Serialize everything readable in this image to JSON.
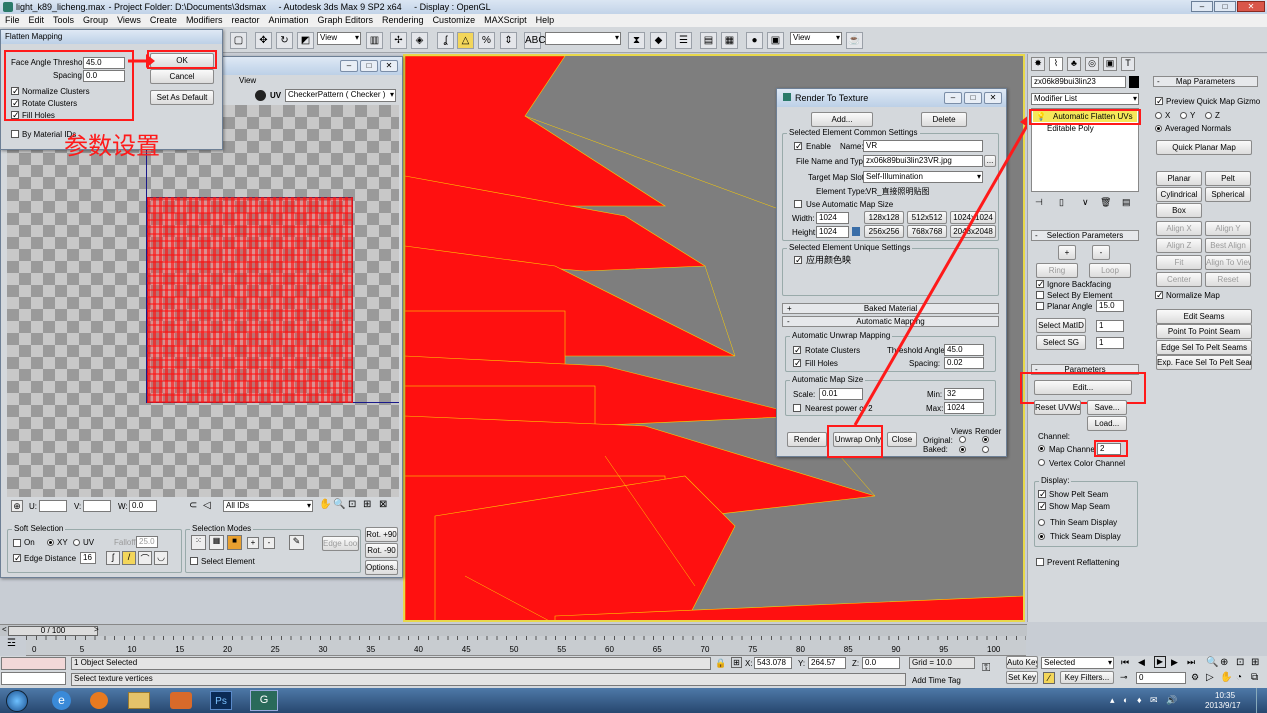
{
  "window": {
    "file": "light_k89_licheng.max",
    "title": " - Project Folder: D:\\Documents\\3dsmax     - Autodesk 3ds Max 9 SP2 x64     - Display : OpenGL"
  },
  "menu": [
    "File",
    "Edit",
    "Tools",
    "Group",
    "Views",
    "Create",
    "Modifiers",
    "reactor",
    "Animation",
    "Graph Editors",
    "Rendering",
    "Customize",
    "MAXScript",
    "Help"
  ],
  "toolbar": {
    "view1": "View",
    "view2": "View"
  },
  "flatten": {
    "title": "Flatten Mapping",
    "face_angle_label": "Face Angle Threshold",
    "face_angle_value": "45.0",
    "spacing_label": "Spacing",
    "spacing_value": "0.0",
    "normalize": "Normalize Clusters",
    "rotate": "Rotate Clusters",
    "fill": "Fill Holes",
    "by_material": "By Material IDs",
    "ok": "OK",
    "cancel": "Cancel",
    "set_default": "Set As Default"
  },
  "annotation": "参数设置",
  "uv_editor": {
    "menu_view": "View",
    "uv_label": "UV",
    "pattern": "CheckerPattern  ( Checker )",
    "u": "U:",
    "v": "V:",
    "w": "W:",
    "w_value": "0.0",
    "all_ids": "All IDs"
  },
  "soft_sel": {
    "title": "Soft Selection",
    "on": "On",
    "xy": "XY",
    "uv": "UV",
    "falloff": "Falloff",
    "falloff_value": "25.0",
    "edge_distance": "Edge Distance",
    "edge_value": "16"
  },
  "sel_modes": {
    "title": "Selection Modes",
    "edge_loop": "Edge Loop",
    "select_element": "Select Element"
  },
  "rotate": {
    "plus90": "Rot. +90",
    "minus90": "Rot. -90",
    "options": "Options..."
  },
  "rtt": {
    "title": "Render To Texture",
    "add": "Add...",
    "delete": "Delete",
    "common": "Selected Element Common Settings",
    "enable": "Enable",
    "name_label": "Name:",
    "name_value": "VR",
    "file_label": "File Name and Type:",
    "file_value": "zx06k89bui3lin23VR.jpg",
    "slot_label": "Target Map Slot:",
    "slot_value": "Self-Illumination",
    "type_label": "Element Type:",
    "type_value": "VR_直接照明贴图",
    "auto_size": "Use Automatic Map Size",
    "width_label": "Width:",
    "width_value": "1024",
    "height_label": "Height:",
    "height_value": "1024",
    "sizes": [
      "128x128",
      "512x512",
      "1024x1024",
      "256x256",
      "768x768",
      "2048x2048"
    ],
    "unique": "Selected Element Unique Settings",
    "color_map": "应用颜色映",
    "baked": "Baked Material",
    "auto_mapping": "Automatic Mapping",
    "auto_unwrap": "Automatic Unwrap Mapping",
    "rot_clusters": "Rotate Clusters",
    "threshold_label": "Threshold Angle:",
    "threshold_value": "45.0",
    "fill_holes": "Fill Holes",
    "spacing_label": "Spacing:",
    "spacing_value": "0.02",
    "auto_map_size": "Automatic Map Size",
    "scale_label": "Scale:",
    "scale_value": "0.01",
    "min_label": "Min:",
    "min_value": "32",
    "nearest": "Nearest power of 2",
    "max_label": "Max:",
    "max_value": "1024",
    "render": "Render",
    "unwrap_only": "Unwrap Only",
    "close": "Close",
    "original": "Original:",
    "baked_lbl": "Baked:",
    "views": "Views",
    "render_col": "Render"
  },
  "cmd": {
    "object_name": "zx06k89bui3lin23",
    "modifier_list": "Modifier List",
    "stack": [
      "Automatic Flatten UVs",
      "Editable Poly"
    ],
    "sel_params": "Selection Parameters",
    "ring": "Ring",
    "loop": "Loop",
    "ignore_back": "Ignore Backfacing",
    "select_by_element": "Select By Element",
    "planar_angle": "Planar Angle",
    "planar_value": "15.0",
    "select_matid": "Select MatID",
    "matid_value": "1",
    "select_sg": "Select SG",
    "sg_value": "1",
    "parameters": "Parameters",
    "edit": "Edit...",
    "reset_uvws": "Reset UVWs",
    "save": "Save...",
    "load": "Load...",
    "channel": "Channel:",
    "map_channel": "Map Channel:",
    "map_channel_value": "2",
    "vertex_color": "Vertex Color Channel",
    "display": "Display:",
    "show_pelt": "Show Pelt Seam",
    "show_map": "Show Map Seam",
    "thin": "Thin Seam Display",
    "thick": "Thick Seam Display",
    "prevent": "Prevent Reflattening"
  },
  "map_params": {
    "title": "Map Parameters",
    "preview": "Preview Quick Map Gizmo",
    "x": "X",
    "y": "Y",
    "z": "Z",
    "averaged": "Averaged Normals",
    "quick_planar": "Quick Planar Map",
    "planar": "Planar",
    "pelt": "Pelt",
    "cylindrical": "Cylindrical",
    "spherical": "Spherical",
    "box": "Box",
    "align_x": "Align X",
    "align_y": "Align Y",
    "align_z": "Align Z",
    "best_align": "Best Align",
    "fit": "Fit",
    "align_to_view": "Align To View",
    "center": "Center",
    "reset": "Reset",
    "normalize_map": "Normalize Map",
    "edit_seams": "Edit Seams",
    "point_to_point": "Point To Point Seam",
    "edge_sel": "Edge Sel To Pelt Seams",
    "exp_face": "Exp. Face Sel To Pelt Seams"
  },
  "timeline": {
    "frame": "0 / 100",
    "ticks": [
      "0",
      "5",
      "10",
      "15",
      "20",
      "25",
      "30",
      "35",
      "40",
      "45",
      "50",
      "55",
      "60",
      "65",
      "70",
      "75",
      "80",
      "85",
      "90",
      "95",
      "100"
    ]
  },
  "status": {
    "selected": "1 Object Selected",
    "prompt": "Select texture vertices",
    "x": "543.078",
    "y": "264.57",
    "z": "0.0",
    "grid": "Grid = 10.0",
    "add_time_tag": "Add Time Tag",
    "auto_key": "Auto Key",
    "set_key": "Set Key",
    "selected_dd": "Selected",
    "key_filters": "Key Filters...",
    "frame_value": "0"
  },
  "taskbar": {
    "time": "10:35",
    "date": "2013/9/17"
  }
}
